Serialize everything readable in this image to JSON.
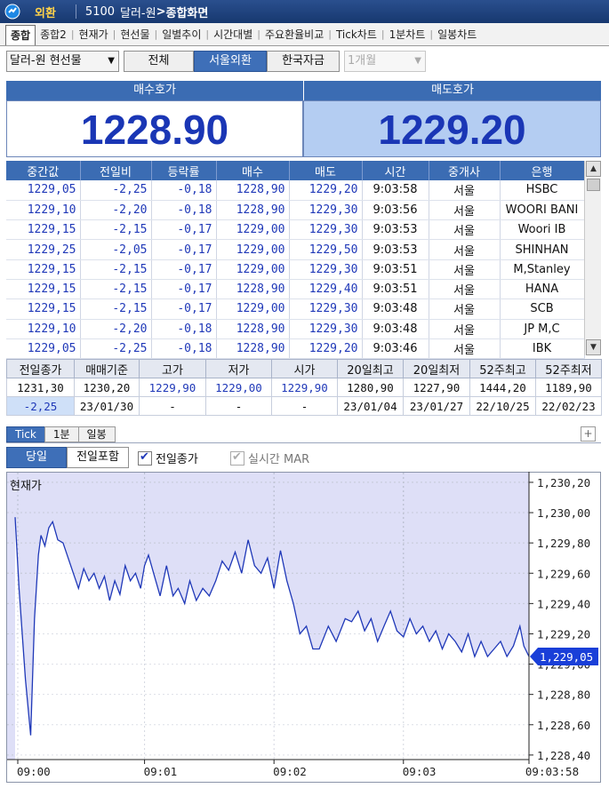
{
  "titlebar": {
    "tag": "외환",
    "screen_no": "5100",
    "path": "달러-원",
    "screen_name": "종합화면"
  },
  "tabs": [
    "종합",
    "종합2",
    "현재가",
    "현선물",
    "일별추이",
    "시간대별",
    "주요환율비교",
    "Tick차트",
    "1분차트",
    "일봉차트"
  ],
  "controls": {
    "instrument": "달러-원 현선물",
    "segments": [
      "전체",
      "서울외환",
      "한국자금"
    ],
    "active_segment": "서울외환",
    "period": "1개월"
  },
  "quote": {
    "bid_label": "매수호가",
    "bid": "1228.90",
    "ask_label": "매도호가",
    "ask": "1229.20"
  },
  "market": {
    "headers": [
      "중간값",
      "전일비",
      "등락률",
      "매수",
      "매도",
      "시간",
      "중개사",
      "은행"
    ],
    "rows": [
      [
        "1229,05",
        "-2,25",
        "-0,18",
        "1228,90",
        "1229,20",
        "9:03:58",
        "서울",
        "HSBC"
      ],
      [
        "1229,10",
        "-2,20",
        "-0,18",
        "1228,90",
        "1229,30",
        "9:03:56",
        "서울",
        "WOORI BANI"
      ],
      [
        "1229,15",
        "-2,15",
        "-0,17",
        "1229,00",
        "1229,30",
        "9:03:53",
        "서울",
        "Woori IB"
      ],
      [
        "1229,25",
        "-2,05",
        "-0,17",
        "1229,00",
        "1229,50",
        "9:03:53",
        "서울",
        "SHINHAN"
      ],
      [
        "1229,15",
        "-2,15",
        "-0,17",
        "1229,00",
        "1229,30",
        "9:03:51",
        "서울",
        "M,Stanley"
      ],
      [
        "1229,15",
        "-2,15",
        "-0,17",
        "1228,90",
        "1229,40",
        "9:03:51",
        "서울",
        "HANA"
      ],
      [
        "1229,15",
        "-2,15",
        "-0,17",
        "1229,00",
        "1229,30",
        "9:03:48",
        "서울",
        "SCB"
      ],
      [
        "1229,10",
        "-2,20",
        "-0,18",
        "1228,90",
        "1229,30",
        "9:03:48",
        "서울",
        "JP M,C"
      ],
      [
        "1229,05",
        "-2,25",
        "-0,18",
        "1228,90",
        "1229,20",
        "9:03:46",
        "서울",
        "IBK"
      ]
    ]
  },
  "summary": {
    "headers": [
      "전일종가",
      "매매기준",
      "고가",
      "저가",
      "시가",
      "20일최고",
      "20일최저",
      "52주최고",
      "52주최저"
    ],
    "row1": [
      "1231,30",
      "1230,20",
      "1229,90",
      "1229,00",
      "1229,90",
      "1280,90",
      "1227,90",
      "1444,20",
      "1189,90"
    ],
    "row2": [
      "-2,25",
      "23/01/30",
      "-",
      "-",
      "-",
      "23/01/04",
      "23/01/27",
      "22/10/25",
      "22/02/23"
    ]
  },
  "chart_tabs": [
    "Tick",
    "1분",
    "일봉"
  ],
  "chart_options": {
    "day_buttons": [
      "당일",
      "전일포함"
    ],
    "active_day": "당일",
    "prev_close_label": "전일종가",
    "prev_close_checked": true,
    "realtime_mar_label": "실시간 MAR",
    "realtime_mar_checked": false
  },
  "chart_data": {
    "type": "line",
    "title": "현재가",
    "x_ticks": [
      "09:00",
      "09:01",
      "09:02",
      "09:03",
      "09:03:58"
    ],
    "y_ticks": [
      "1,230,20",
      "1,230,00",
      "1,229,80",
      "1,229,60",
      "1,229,40",
      "1,229,20",
      "1,229,00",
      "1,228,80",
      "1,228,60",
      "1,228,40"
    ],
    "ylim": [
      1228.37,
      1230.27
    ],
    "current_value_label": "1,229,05",
    "current_value": 1229.05,
    "line_color": "#1f38b8",
    "fill_color": "#dadcf6",
    "x_minutes": [
      0,
      0.03,
      0.08,
      0.12,
      0.15,
      0.18,
      0.2,
      0.23,
      0.26,
      0.29,
      0.33,
      0.37,
      0.41,
      0.45,
      0.49,
      0.53,
      0.57,
      0.61,
      0.65,
      0.69,
      0.73,
      0.77,
      0.81,
      0.85,
      0.89,
      0.93,
      0.97,
      1.0,
      1.03,
      1.07,
      1.12,
      1.17,
      1.22,
      1.26,
      1.31,
      1.35,
      1.4,
      1.45,
      1.5,
      1.55,
      1.6,
      1.65,
      1.7,
      1.75,
      1.8,
      1.85,
      1.9,
      1.95,
      2.0,
      2.05,
      2.1,
      2.15,
      2.2,
      2.25,
      2.3,
      2.35,
      2.42,
      2.48,
      2.55,
      2.6,
      2.65,
      2.7,
      2.75,
      2.8,
      2.85,
      2.9,
      2.95,
      3.0,
      3.05,
      3.1,
      3.15,
      3.2,
      3.25,
      3.3,
      3.35,
      3.4,
      3.45,
      3.5,
      3.55,
      3.6,
      3.65,
      3.7,
      3.75,
      3.8,
      3.85,
      3.9,
      3.93,
      3.97
    ],
    "y_values": [
      1229.97,
      1229.5,
      1228.9,
      1228.53,
      1229.3,
      1229.72,
      1229.85,
      1229.78,
      1229.9,
      1229.94,
      1229.82,
      1229.8,
      1229.7,
      1229.6,
      1229.5,
      1229.63,
      1229.55,
      1229.6,
      1229.5,
      1229.58,
      1229.42,
      1229.55,
      1229.46,
      1229.65,
      1229.55,
      1229.6,
      1229.5,
      1229.65,
      1229.72,
      1229.6,
      1229.45,
      1229.65,
      1229.45,
      1229.5,
      1229.4,
      1229.55,
      1229.42,
      1229.5,
      1229.45,
      1229.55,
      1229.68,
      1229.62,
      1229.74,
      1229.6,
      1229.82,
      1229.65,
      1229.6,
      1229.7,
      1229.5,
      1229.75,
      1229.55,
      1229.4,
      1229.2,
      1229.25,
      1229.1,
      1229.1,
      1229.25,
      1229.15,
      1229.3,
      1229.28,
      1229.35,
      1229.22,
      1229.3,
      1229.15,
      1229.25,
      1229.35,
      1229.22,
      1229.18,
      1229.3,
      1229.2,
      1229.25,
      1229.15,
      1229.22,
      1229.1,
      1229.2,
      1229.15,
      1229.08,
      1229.2,
      1229.05,
      1229.15,
      1229.05,
      1229.1,
      1229.15,
      1229.05,
      1229.12,
      1229.25,
      1229.12,
      1229.05
    ]
  }
}
